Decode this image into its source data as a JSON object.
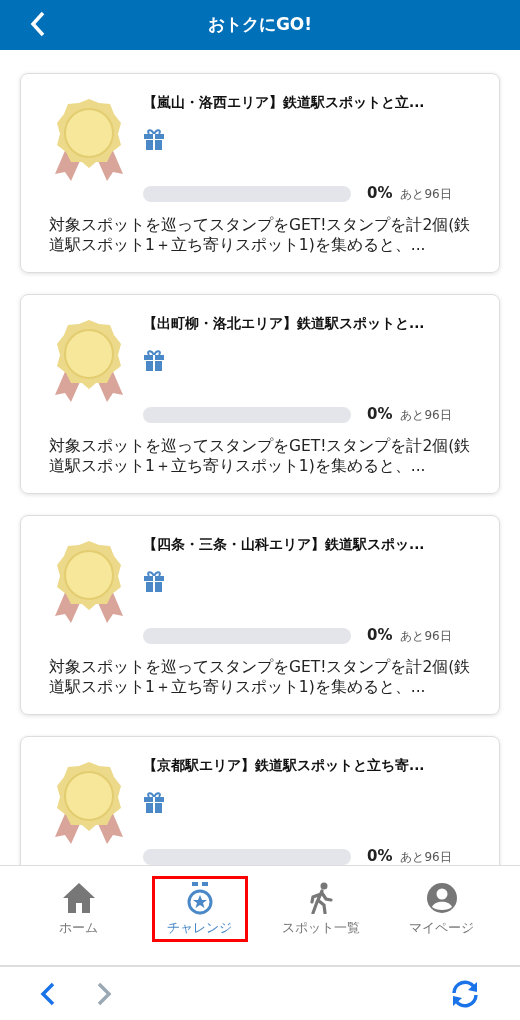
{
  "header": {
    "title": "おトクにGO!"
  },
  "challenges": [
    {
      "title": "【嵐山・洛西エリア】鉄道駅スポットと立...",
      "level": 0,
      "percent": "0%",
      "remaining": "あと96日",
      "description": "対象スポットを巡ってスタンプをGET!スタンプを計2個(鉄道駅スポット1＋立ち寄りスポット1)を集めると、..."
    },
    {
      "title": "【出町柳・洛北エリア】鉄道駅スポットと...",
      "level": 0,
      "percent": "0%",
      "remaining": "あと96日",
      "description": "対象スポットを巡ってスタンプをGET!スタンプを計2個(鉄道駅スポット1＋立ち寄りスポット1)を集めると、..."
    },
    {
      "title": "【四条・三条・山科エリア】鉄道駅スポッ...",
      "level": 0,
      "percent": "0%",
      "remaining": "あと96日",
      "description": "対象スポットを巡ってスタンプをGET!スタンプを計2個(鉄道駅スポット1＋立ち寄りスポット1)を集めると、..."
    },
    {
      "title": "【京都駅エリア】鉄道駅スポットと立ち寄...",
      "level": 0,
      "percent": "0%",
      "remaining": "あと96日"
    }
  ],
  "tab_bar": [
    {
      "kind": "home",
      "label": "ホーム",
      "selected": false,
      "highlighted": false
    },
    {
      "kind": "challenge",
      "label": "チャレンジ",
      "selected": true,
      "highlighted": true
    },
    {
      "kind": "spots",
      "label": "スポット一覧",
      "selected": false,
      "highlighted": false
    },
    {
      "kind": "mypage",
      "label": "マイページ",
      "selected": false,
      "highlighted": false
    }
  ],
  "browser_bar": {
    "back_disabled": false,
    "forward_disabled": true
  }
}
